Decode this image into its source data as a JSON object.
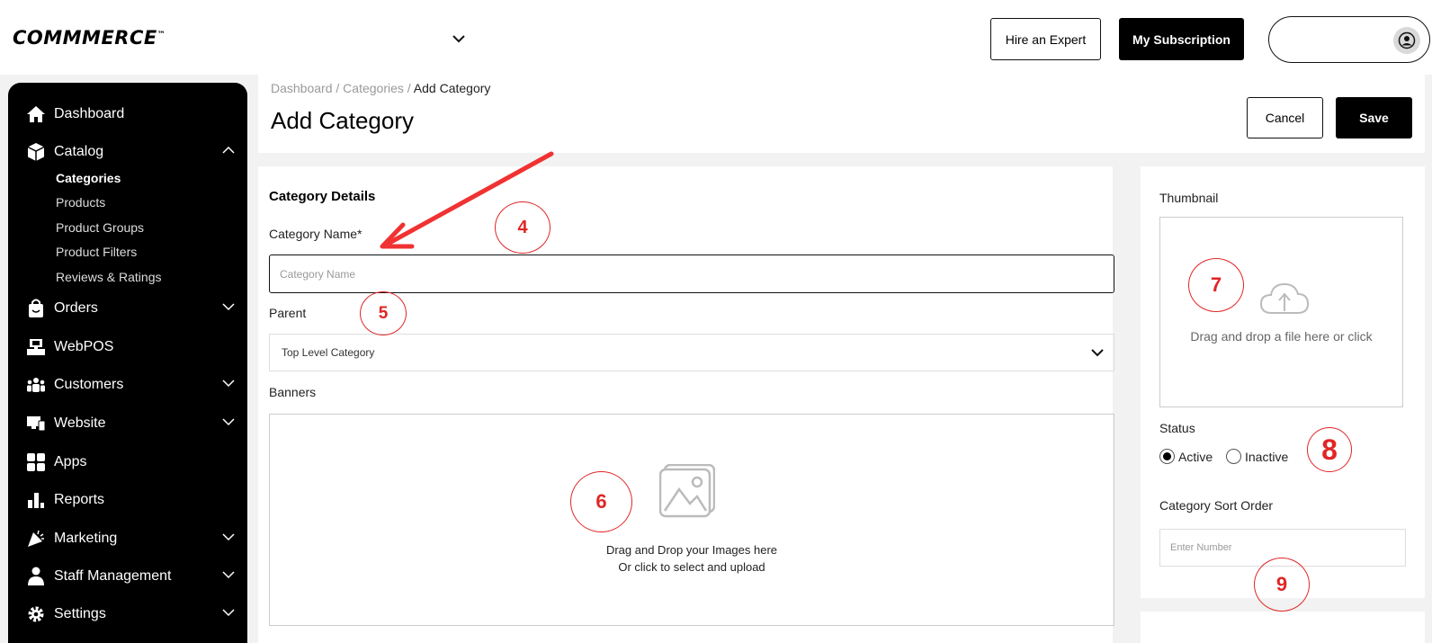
{
  "header": {
    "logo": "COMMMERCE",
    "logo_tm": "™",
    "hire_label": "Hire an Expert",
    "subscription_label": "My Subscription"
  },
  "sidebar": {
    "items": [
      {
        "label": "Dashboard",
        "icon": "home-icon"
      },
      {
        "label": "Catalog",
        "icon": "box-icon",
        "expanded": true
      },
      {
        "label": "Orders",
        "icon": "shopping-bag-icon"
      },
      {
        "label": "WebPOS",
        "icon": "pos-icon"
      },
      {
        "label": "Customers",
        "icon": "users-icon"
      },
      {
        "label": "Website",
        "icon": "monitor-icon"
      },
      {
        "label": "Apps",
        "icon": "apps-grid-icon"
      },
      {
        "label": "Reports",
        "icon": "bar-chart-icon"
      },
      {
        "label": "Marketing",
        "icon": "megaphone-icon"
      },
      {
        "label": "Staff Management",
        "icon": "staff-icon"
      },
      {
        "label": "Settings",
        "icon": "gear-icon"
      }
    ],
    "catalog_sub": [
      "Categories",
      "Products",
      "Product Groups",
      "Product Filters",
      "Reviews & Ratings"
    ],
    "active_sub": "Categories"
  },
  "page": {
    "breadcrumb": [
      "Dashboard",
      "Categories",
      "Add Category"
    ],
    "breadcrumb_sep": " / ",
    "title": "Add Category",
    "cancel_label": "Cancel",
    "save_label": "Save"
  },
  "form": {
    "section_title": "Category Details",
    "name_label": "Category Name*",
    "name_placeholder": "Category Name",
    "name_value": "",
    "parent_label": "Parent",
    "parent_value": "Top Level Category",
    "banners_label": "Banners",
    "banner_line1": "Drag and Drop your Images here",
    "banner_line2": "Or click to select and upload"
  },
  "side": {
    "thumbnail_label": "Thumbnail",
    "thumbnail_text": "Drag and drop a file here or click",
    "status_label": "Status",
    "status_options": [
      "Active",
      "Inactive"
    ],
    "status_selected": "Active",
    "sort_label": "Category Sort Order",
    "sort_placeholder": "Enter Number"
  },
  "annotations": [
    "4",
    "5",
    "6",
    "7",
    "8",
    "9"
  ],
  "colors": {
    "accent": "#000000",
    "annotation": "#e02626",
    "background": "#f2f2f2"
  }
}
